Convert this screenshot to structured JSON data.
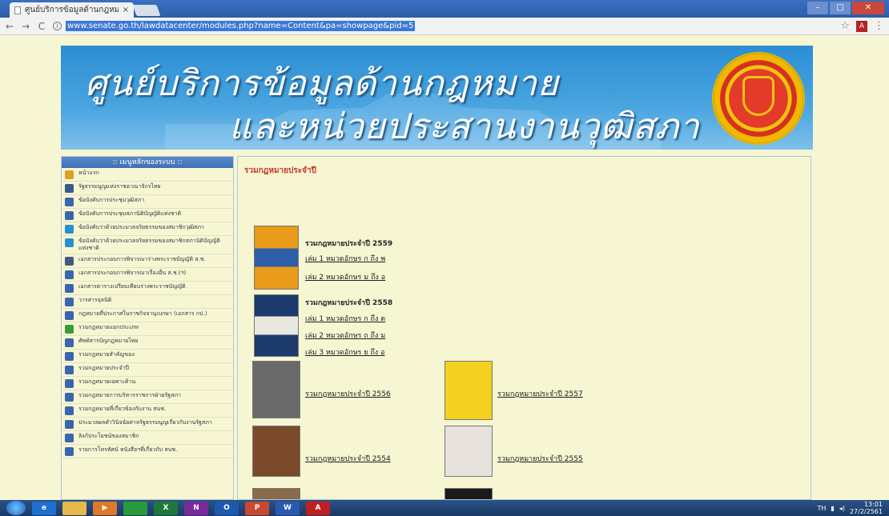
{
  "browser": {
    "tab_title": "ศูนย์บริการข้อมูลด้านกฎหมาย",
    "tab_close": "×",
    "url": "www.senate.go.th/lawdatacenter/modules.php?name=Content&pa=showpage&pid=5",
    "info_glyph": "i",
    "back": "←",
    "forward": "→",
    "reload": "C",
    "star": "☆",
    "menu": "⋮",
    "extension_label": "A"
  },
  "banner": {
    "line1": "ศูนย์บริการข้อมูลด้านกฎหมาย",
    "line2": "และหน่วยประสานงานวุฒิสภา"
  },
  "sidebar": {
    "heading": ":: เมนูหลักของระบบ ::",
    "items": [
      {
        "label": "หน้าแรก",
        "color": "#e0a020"
      },
      {
        "label": "รัฐธรรมนูญแห่งราชอาณาจักรไทย",
        "color": "#3a5a8c"
      },
      {
        "label": "ข้อบังคับการประชุมวุฒิสภา",
        "color": "#3a66b0"
      },
      {
        "label": "ข้อบังคับการประชุมสภานิติบัญญัติแห่งชาติ",
        "color": "#3a66b0"
      },
      {
        "label": "ข้อบังคับว่าด้วยประมวลจริยธรรมของสมาชิกวุฒิสภา",
        "color": "#2a8fd0"
      },
      {
        "label": "ข้อบังคับว่าด้วยประมวลจริยธรรมของสมาชิกสภานิติบัญญัติแห่งชาติ",
        "color": "#2a8fd0"
      },
      {
        "label": "เอกสารประกอบการพิจารณาร่างพระราชบัญญัติ ส.ช.",
        "color": "#445a80"
      },
      {
        "label": "เอกสารประกอบการพิจารณาเรื่องอื่น ส.ช.(ฯ)",
        "color": "#3a66b0"
      },
      {
        "label": "เอกสารตารางเปรียบเทียบร่างพระราชบัญญัติ",
        "color": "#3a66b0"
      },
      {
        "label": "วารสารจุลนิติ",
        "color": "#3a66b0"
      },
      {
        "label": "กฎหมายที่ประกาศในราชกิจจานุเบกษา (เอกสาร กป.)",
        "color": "#3a66b0"
      },
      {
        "label": "รวมกฎหมายแยกประเภท",
        "color": "#3a9a3a"
      },
      {
        "label": "ศัพท์สารบัญกฎหมายไทย",
        "color": "#3a66b0"
      },
      {
        "label": "รวมกฎหมายสำคัญของ",
        "color": "#3a66b0"
      },
      {
        "label": "รวมกฎหมายประจำปี",
        "color": "#3a66b0"
      },
      {
        "label": "รวมกฎหมายเฉพาะด้าน",
        "color": "#3a66b0"
      },
      {
        "label": "รวมกฎหมายการบริหารราชการฝ่ายรัฐสภา",
        "color": "#3a66b0"
      },
      {
        "label": "รวมกฎหมายที่เกี่ยวข้องกับงาน สนช.",
        "color": "#3a66b0"
      },
      {
        "label": "ประมวลผลคำวินิจฉัยศาลรัฐธรรมนูญเกี่ยวกับงานรัฐสภา",
        "color": "#3a66b0"
      },
      {
        "label": "ลิงก์ประโยชน์ของสมาชิก",
        "color": "#3a66b0"
      },
      {
        "label": "รายการโทรทัศน์ หนังสือฯที่เกี่ยวกับ สนช.",
        "color": "#3a66b0"
      }
    ]
  },
  "main": {
    "title": "รวมกฎหมายประจำปี",
    "groups": [
      {
        "title": "รวมกฎหมายประจำปี 2559",
        "volumes": [
          "เล่ม 1 หมวดอักษร ก ถึง พ",
          "เล่ม 2 หมวดอักษร ม ถึง อ"
        ],
        "cover_color": "#e89a1a",
        "cover_band": "#2d5fa8"
      },
      {
        "title": "รวมกฎหมายประจำปี 2558",
        "volumes": [
          "เล่ม 1 หมวดอักษร ก ถึง ต",
          "เล่ม 2 หมวดอักษร ถ ถึง ม",
          "เล่ม 3 หมวดอักษร ย ถึง อ"
        ],
        "cover_color": "#1c3a6b",
        "cover_band": "#e8e8e0"
      }
    ],
    "years": [
      {
        "label": "รวมกฎหมายประจำปี 2556",
        "cover_color": "#6a6a6a"
      },
      {
        "label": "รวมกฎหมายประจำปี 2557",
        "cover_color": "#f4d020"
      },
      {
        "label": "รวมกฎหมายประจำปี 2554",
        "cover_color": "#7a4a2a"
      },
      {
        "label": "รวมกฎหมายประจำปี 2555",
        "cover_color": "#e8e2dc"
      }
    ]
  },
  "taskbar": {
    "apps": [
      {
        "name": "ie",
        "label": "e",
        "color": "#1e6fd0"
      },
      {
        "name": "explorer",
        "label": "",
        "color": "#e6b94a"
      },
      {
        "name": "media",
        "label": "▶",
        "color": "#e0782a"
      },
      {
        "name": "chrome",
        "label": "",
        "color": "#2a9a3a"
      },
      {
        "name": "excel",
        "label": "X",
        "color": "#1e7a3a"
      },
      {
        "name": "onenote",
        "label": "N",
        "color": "#7a2a9a"
      },
      {
        "name": "outlook",
        "label": "O",
        "color": "#1a5ab0"
      },
      {
        "name": "powerpoint",
        "label": "P",
        "color": "#c84a2a"
      },
      {
        "name": "word",
        "label": "W",
        "color": "#2a5ab0"
      },
      {
        "name": "acrobat",
        "label": "A",
        "color": "#c02020"
      }
    ],
    "lang": "TH",
    "time": "13:01",
    "date": "27/2/2561"
  }
}
